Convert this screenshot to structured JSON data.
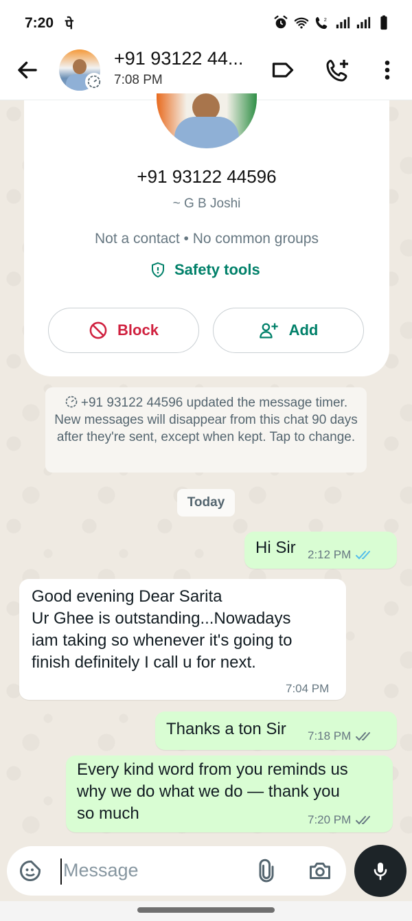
{
  "status_bar": {
    "time": "7:20",
    "carrier_glyph": "पे",
    "icons": [
      "alarm-icon",
      "wifi-icon",
      "wifi-calling-icon",
      "signal-icon",
      "signal-icon",
      "battery-icon"
    ]
  },
  "header": {
    "title": "+91 93122 44...",
    "subtitle": "7:08 PM",
    "icons": [
      "back-arrow-icon",
      "label-icon",
      "add-call-icon",
      "more-vert-icon"
    ]
  },
  "profile_card": {
    "phone": "+91 93122 44596",
    "display_name": "~ G B Joshi",
    "meta": "Not a contact • No common groups",
    "safety_label": "Safety tools",
    "block_label": "Block",
    "add_label": "Add"
  },
  "system_notice": {
    "text": "+91 93122 44596 updated the message timer. New messages will disappear from this chat 90 days after they're sent, except when kept. Tap to change."
  },
  "date_divider": "Today",
  "messages": [
    {
      "direction": "out",
      "text": "Hi Sir",
      "time": "2:12 PM",
      "status": "read"
    },
    {
      "direction": "in",
      "lines": [
        "Good evening Dear Sarita",
        "Ur Ghee is outstanding...Nowadays",
        "iam taking so whenever it's  going to",
        "finish  definitely I call u for next."
      ],
      "time": "7:04 PM"
    },
    {
      "direction": "out",
      "text": "Thanks a ton Sir",
      "time": "7:18 PM",
      "status": "delivered"
    },
    {
      "direction": "out",
      "lines": [
        "Every kind word from you reminds us",
        "why we do what we do — thank you",
        "so much"
      ],
      "time": "7:20 PM",
      "status": "delivered"
    }
  ],
  "composer": {
    "placeholder": "Message",
    "icons": [
      "emoji-sticker-icon",
      "attach-icon",
      "camera-icon",
      "mic-icon"
    ]
  },
  "colors": {
    "accent_green": "#008069",
    "outgoing_bubble": "#d9fdd3",
    "incoming_bubble": "#ffffff",
    "block_red": "#d0213f",
    "read_tick_blue": "#53bdeb",
    "chat_background": "#efeae2"
  }
}
